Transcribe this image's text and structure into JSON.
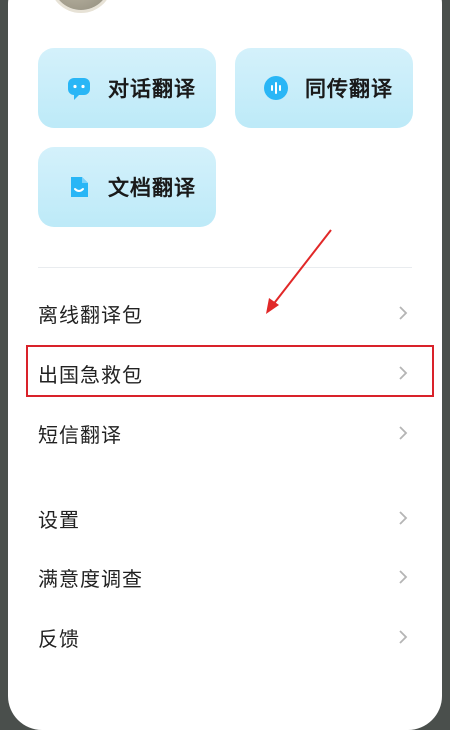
{
  "cards": [
    {
      "label": "对话翻译",
      "icon": "chat-bubble-icon"
    },
    {
      "label": "同传翻译",
      "icon": "audio-wave-icon"
    },
    {
      "label": "文档翻译",
      "icon": "document-icon"
    }
  ],
  "menu": [
    {
      "label": "离线翻译包"
    },
    {
      "label": "出国急救包"
    },
    {
      "label": "短信翻译"
    },
    {
      "label": "设置"
    },
    {
      "label": "满意度调查"
    },
    {
      "label": "反馈"
    }
  ],
  "colors": {
    "card_bg": "#c9eef9",
    "icon_blue": "#29b6f6",
    "highlight": "#d9222a",
    "arrow": "#e12828"
  }
}
